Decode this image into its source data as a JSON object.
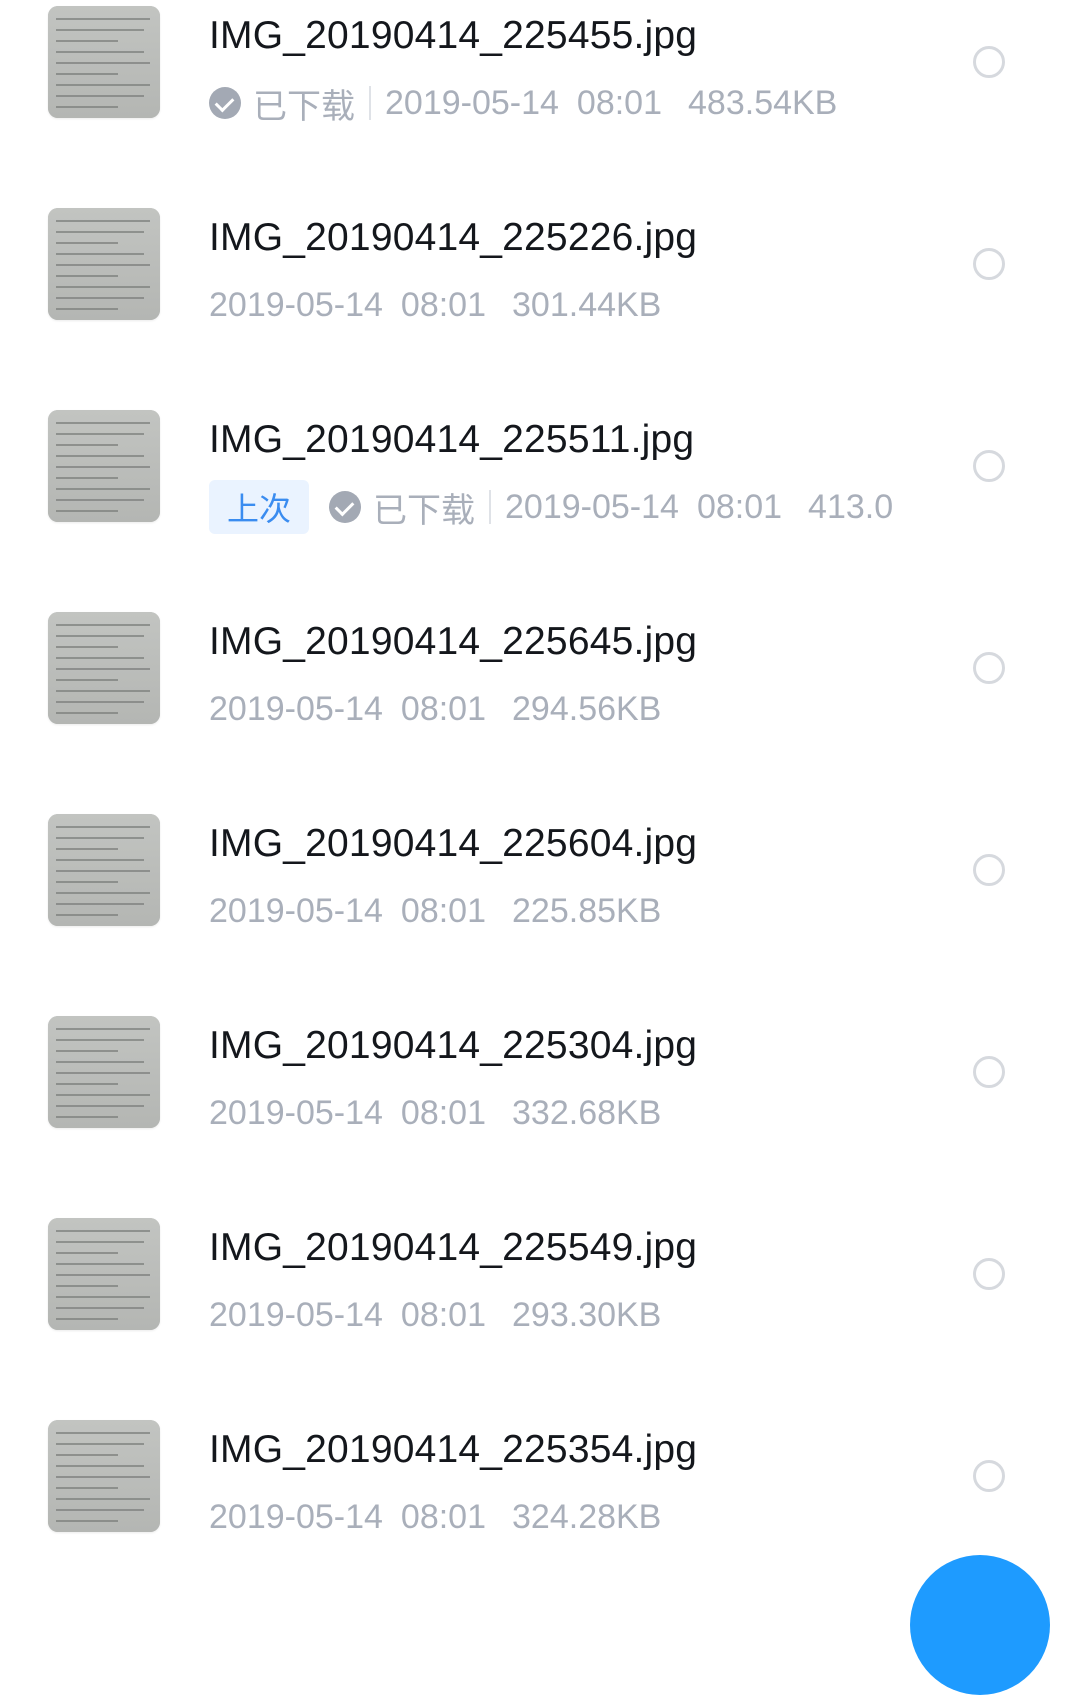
{
  "files": [
    {
      "name": "IMG_20190414_225455.jpg",
      "tag": "",
      "downloaded": "已下载",
      "date": "2019-05-14",
      "time": "08:01",
      "size": "483.54KB"
    },
    {
      "name": "IMG_20190414_225226.jpg",
      "tag": "",
      "downloaded": "",
      "date": "2019-05-14",
      "time": "08:01",
      "size": "301.44KB"
    },
    {
      "name": "IMG_20190414_225511.jpg",
      "tag": "上次",
      "downloaded": "已下载",
      "date": "2019-05-14",
      "time": "08:01",
      "size": "413.0"
    },
    {
      "name": "IMG_20190414_225645.jpg",
      "tag": "",
      "downloaded": "",
      "date": "2019-05-14",
      "time": "08:01",
      "size": "294.56KB"
    },
    {
      "name": "IMG_20190414_225604.jpg",
      "tag": "",
      "downloaded": "",
      "date": "2019-05-14",
      "time": "08:01",
      "size": "225.85KB"
    },
    {
      "name": "IMG_20190414_225304.jpg",
      "tag": "",
      "downloaded": "",
      "date": "2019-05-14",
      "time": "08:01",
      "size": "332.68KB"
    },
    {
      "name": "IMG_20190414_225549.jpg",
      "tag": "",
      "downloaded": "",
      "date": "2019-05-14",
      "time": "08:01",
      "size": "293.30KB"
    },
    {
      "name": "IMG_20190414_225354.jpg",
      "tag": "",
      "downloaded": "",
      "date": "2019-05-14",
      "time": "08:01",
      "size": "324.28KB"
    }
  ],
  "icons": {
    "downloaded": "check-circle-icon",
    "select": "radio-circle-icon"
  },
  "colors": {
    "accent": "#1e9bff",
    "tag_bg": "#eaf3ff",
    "tag_text": "#3a8cf0",
    "meta_text": "#a9afba",
    "name_text": "#14171c"
  }
}
